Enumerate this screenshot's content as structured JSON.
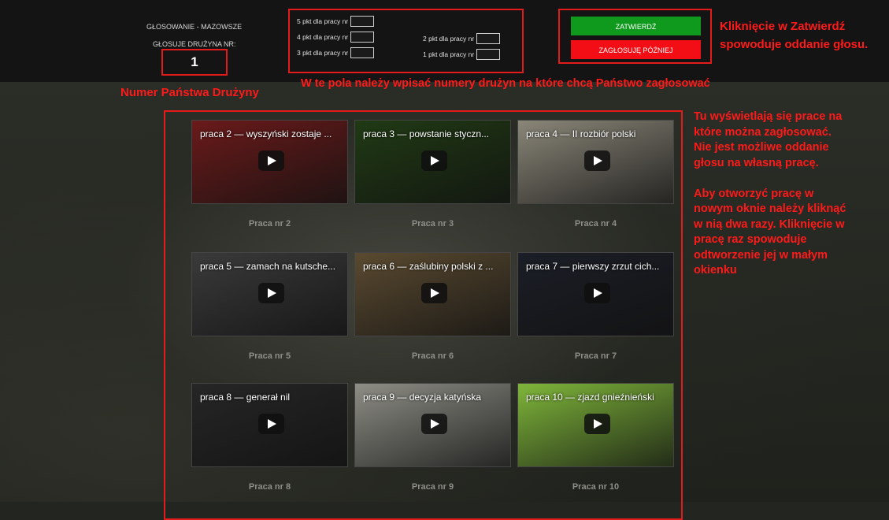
{
  "header": {
    "voting_title": "GŁOSOWANIE - MAZOWSZE",
    "team_label": "GŁOSUJE DRUŻYNA NR:",
    "team_number": "1"
  },
  "points": [
    {
      "label": "5 pkt dla pracy nr",
      "value": ""
    },
    {
      "label": "4 pkt dla pracy nr",
      "value": ""
    },
    {
      "label": "3 pkt dla pracy nr",
      "value": ""
    },
    {
      "label": "2 pkt dla pracy nr",
      "value": ""
    },
    {
      "label": "1 pkt dla pracy nr",
      "value": ""
    }
  ],
  "buttons": {
    "confirm": "ZATWIERDŹ",
    "later": "ZAGŁOSUJĘ PÓŹNIEJ"
  },
  "notes": {
    "confirm_note_1": "Kliknięcie w Zatwierdź",
    "confirm_note_2": "spowoduje oddanie głosu.",
    "team_note": "Numer Państwa Drużyny",
    "fields_note": "W te pola należy wpisać numery drużyn na które chcą Państwo zagłosować",
    "side_note_lines": [
      "Tu wyświetlają się prace na",
      "które można zagłosować.",
      "Nie jest możliwe oddanie",
      "głosu na własną pracę.",
      "",
      "Aby otworzyć pracę w",
      "nowym oknie należy kliknąć",
      "w nią dwa razy. Kliknięcie w",
      "pracę raz spowoduje",
      "odtworzenie jej w małym",
      "okienku"
    ]
  },
  "works": [
    {
      "title": "praca 2 — wyszyński zostaje ...",
      "caption": "Praca nr 2",
      "thumb_color": "#6a1a1a"
    },
    {
      "title": "praca 3 — powstanie styczn...",
      "caption": "Praca nr 3",
      "thumb_color": "#203a14"
    },
    {
      "title": "praca 4 — II rozbiór polski",
      "caption": "Praca nr 4",
      "thumb_color": "#8a8678"
    },
    {
      "title": "praca 5 — zamach na kutsche...",
      "caption": "Praca nr 5",
      "thumb_color": "#3a3a3a"
    },
    {
      "title": "praca 6 — zaślubiny polski z ...",
      "caption": "Praca nr 6",
      "thumb_color": "#5a4a30"
    },
    {
      "title": "praca 7 — pierwszy zrzut cich...",
      "caption": "Praca nr 7",
      "thumb_color": "#1b1e26"
    },
    {
      "title": "praca 8 — generał nil",
      "caption": "Praca nr 8",
      "thumb_color": "#262626"
    },
    {
      "title": "praca 9 — decyzja katyńska",
      "caption": "Praca nr 9",
      "thumb_color": "#8e8e86"
    },
    {
      "title": "praca 10 — zjazd gnieźnieński",
      "caption": "Praca nr 10",
      "thumb_color": "#7fb63a"
    }
  ]
}
